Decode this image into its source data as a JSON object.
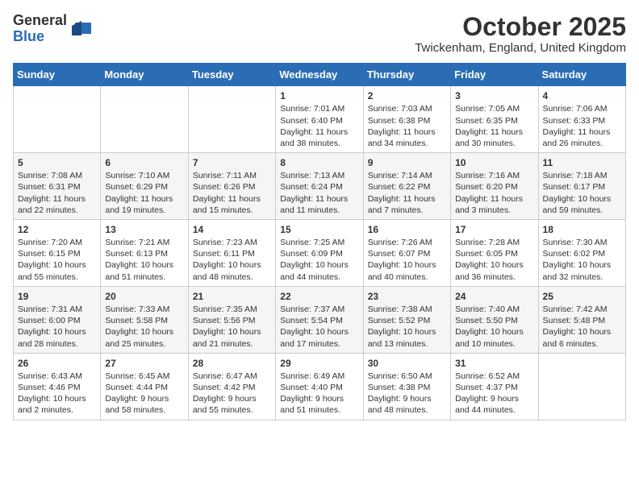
{
  "logo": {
    "general": "General",
    "blue": "Blue"
  },
  "title": "October 2025",
  "location": "Twickenham, England, United Kingdom",
  "days_header": [
    "Sunday",
    "Monday",
    "Tuesday",
    "Wednesday",
    "Thursday",
    "Friday",
    "Saturday"
  ],
  "weeks": [
    [
      {
        "day": "",
        "info": ""
      },
      {
        "day": "",
        "info": ""
      },
      {
        "day": "",
        "info": ""
      },
      {
        "day": "1",
        "info": "Sunrise: 7:01 AM\nSunset: 6:40 PM\nDaylight: 11 hours\nand 38 minutes."
      },
      {
        "day": "2",
        "info": "Sunrise: 7:03 AM\nSunset: 6:38 PM\nDaylight: 11 hours\nand 34 minutes."
      },
      {
        "day": "3",
        "info": "Sunrise: 7:05 AM\nSunset: 6:35 PM\nDaylight: 11 hours\nand 30 minutes."
      },
      {
        "day": "4",
        "info": "Sunrise: 7:06 AM\nSunset: 6:33 PM\nDaylight: 11 hours\nand 26 minutes."
      }
    ],
    [
      {
        "day": "5",
        "info": "Sunrise: 7:08 AM\nSunset: 6:31 PM\nDaylight: 11 hours\nand 22 minutes."
      },
      {
        "day": "6",
        "info": "Sunrise: 7:10 AM\nSunset: 6:29 PM\nDaylight: 11 hours\nand 19 minutes."
      },
      {
        "day": "7",
        "info": "Sunrise: 7:11 AM\nSunset: 6:26 PM\nDaylight: 11 hours\nand 15 minutes."
      },
      {
        "day": "8",
        "info": "Sunrise: 7:13 AM\nSunset: 6:24 PM\nDaylight: 11 hours\nand 11 minutes."
      },
      {
        "day": "9",
        "info": "Sunrise: 7:14 AM\nSunset: 6:22 PM\nDaylight: 11 hours\nand 7 minutes."
      },
      {
        "day": "10",
        "info": "Sunrise: 7:16 AM\nSunset: 6:20 PM\nDaylight: 11 hours\nand 3 minutes."
      },
      {
        "day": "11",
        "info": "Sunrise: 7:18 AM\nSunset: 6:17 PM\nDaylight: 10 hours\nand 59 minutes."
      }
    ],
    [
      {
        "day": "12",
        "info": "Sunrise: 7:20 AM\nSunset: 6:15 PM\nDaylight: 10 hours\nand 55 minutes."
      },
      {
        "day": "13",
        "info": "Sunrise: 7:21 AM\nSunset: 6:13 PM\nDaylight: 10 hours\nand 51 minutes."
      },
      {
        "day": "14",
        "info": "Sunrise: 7:23 AM\nSunset: 6:11 PM\nDaylight: 10 hours\nand 48 minutes."
      },
      {
        "day": "15",
        "info": "Sunrise: 7:25 AM\nSunset: 6:09 PM\nDaylight: 10 hours\nand 44 minutes."
      },
      {
        "day": "16",
        "info": "Sunrise: 7:26 AM\nSunset: 6:07 PM\nDaylight: 10 hours\nand 40 minutes."
      },
      {
        "day": "17",
        "info": "Sunrise: 7:28 AM\nSunset: 6:05 PM\nDaylight: 10 hours\nand 36 minutes."
      },
      {
        "day": "18",
        "info": "Sunrise: 7:30 AM\nSunset: 6:02 PM\nDaylight: 10 hours\nand 32 minutes."
      }
    ],
    [
      {
        "day": "19",
        "info": "Sunrise: 7:31 AM\nSunset: 6:00 PM\nDaylight: 10 hours\nand 28 minutes."
      },
      {
        "day": "20",
        "info": "Sunrise: 7:33 AM\nSunset: 5:58 PM\nDaylight: 10 hours\nand 25 minutes."
      },
      {
        "day": "21",
        "info": "Sunrise: 7:35 AM\nSunset: 5:56 PM\nDaylight: 10 hours\nand 21 minutes."
      },
      {
        "day": "22",
        "info": "Sunrise: 7:37 AM\nSunset: 5:54 PM\nDaylight: 10 hours\nand 17 minutes."
      },
      {
        "day": "23",
        "info": "Sunrise: 7:38 AM\nSunset: 5:52 PM\nDaylight: 10 hours\nand 13 minutes."
      },
      {
        "day": "24",
        "info": "Sunrise: 7:40 AM\nSunset: 5:50 PM\nDaylight: 10 hours\nand 10 minutes."
      },
      {
        "day": "25",
        "info": "Sunrise: 7:42 AM\nSunset: 5:48 PM\nDaylight: 10 hours\nand 6 minutes."
      }
    ],
    [
      {
        "day": "26",
        "info": "Sunrise: 6:43 AM\nSunset: 4:46 PM\nDaylight: 10 hours\nand 2 minutes."
      },
      {
        "day": "27",
        "info": "Sunrise: 6:45 AM\nSunset: 4:44 PM\nDaylight: 9 hours\nand 58 minutes."
      },
      {
        "day": "28",
        "info": "Sunrise: 6:47 AM\nSunset: 4:42 PM\nDaylight: 9 hours\nand 55 minutes."
      },
      {
        "day": "29",
        "info": "Sunrise: 6:49 AM\nSunset: 4:40 PM\nDaylight: 9 hours\nand 51 minutes."
      },
      {
        "day": "30",
        "info": "Sunrise: 6:50 AM\nSunset: 4:38 PM\nDaylight: 9 hours\nand 48 minutes."
      },
      {
        "day": "31",
        "info": "Sunrise: 6:52 AM\nSunset: 4:37 PM\nDaylight: 9 hours\nand 44 minutes."
      },
      {
        "day": "",
        "info": ""
      }
    ]
  ]
}
